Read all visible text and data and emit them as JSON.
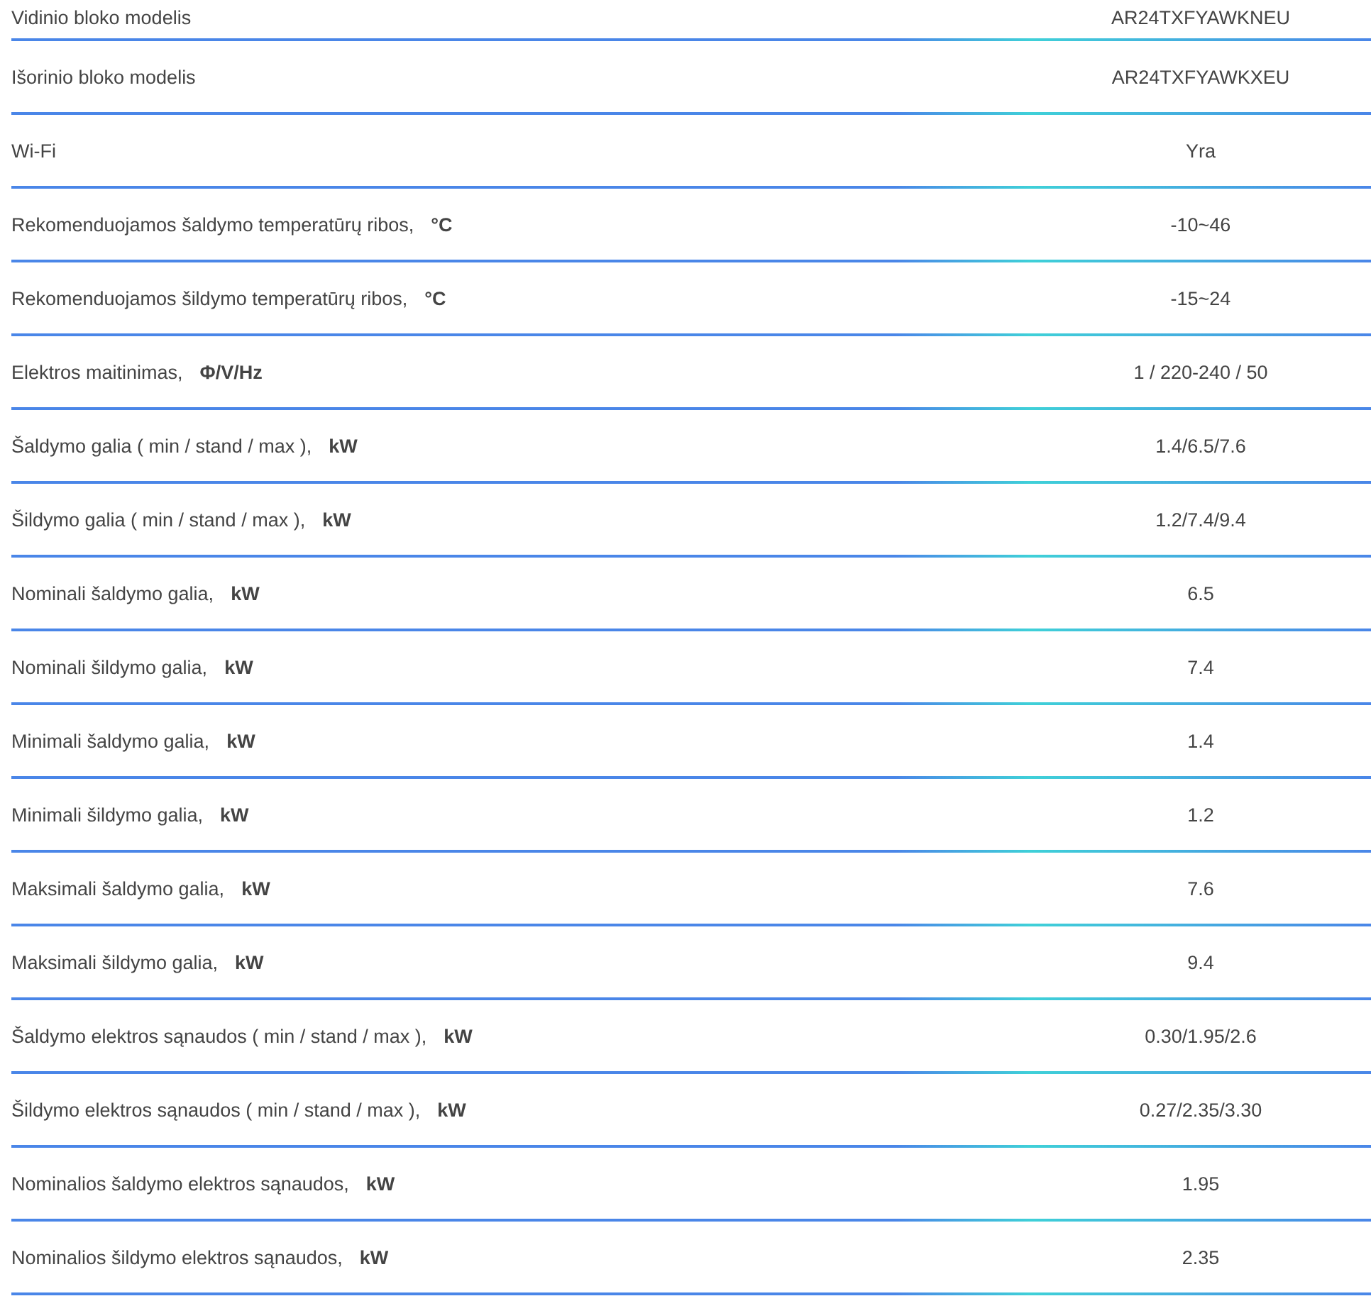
{
  "rows": [
    {
      "label": "Vidinio bloko modelis",
      "value": "AR24TXFYAWKNEU"
    },
    {
      "label": "Išorinio bloko modelis",
      "value": "AR24TXFYAWKXEU"
    },
    {
      "label": "Wi-Fi",
      "value": "Yra"
    },
    {
      "label": "Rekomenduojamos šaldymo temperatūrų ribos,",
      "unit": "°C",
      "value": "-10~46"
    },
    {
      "label": "Rekomenduojamos šildymo temperatūrų ribos,",
      "unit": "°C",
      "value": "-15~24"
    },
    {
      "label": "Elektros maitinimas,",
      "unit": "Φ/V/Hz",
      "value": "1 / 220-240 / 50"
    },
    {
      "label": "Šaldymo galia ( min / stand / max ),",
      "unit": "kW",
      "value": "1.4/6.5/7.6"
    },
    {
      "label": "Šildymo galia ( min / stand / max ),",
      "unit": "kW",
      "value": "1.2/7.4/9.4"
    },
    {
      "label": "Nominali šaldymo galia,",
      "unit": "kW",
      "value": "6.5"
    },
    {
      "label": "Nominali šildymo galia,",
      "unit": "kW",
      "value": "7.4"
    },
    {
      "label": "Minimali šaldymo galia,",
      "unit": "kW",
      "value": "1.4"
    },
    {
      "label": "Minimali šildymo galia,",
      "unit": "kW",
      "value": "1.2"
    },
    {
      "label": "Maksimali šaldymo galia,",
      "unit": "kW",
      "value": "7.6"
    },
    {
      "label": "Maksimali šildymo galia,",
      "unit": "kW",
      "value": "9.4"
    },
    {
      "label": "Šaldymo elektros sąnaudos ( min / stand / max ),",
      "unit": "kW",
      "value": "0.30/1.95/2.6"
    },
    {
      "label": "Šildymo elektros sąnaudos ( min / stand / max ),",
      "unit": "kW",
      "value": "0.27/2.35/3.30"
    },
    {
      "label": "Nominalios šaldymo elektros sąnaudos,",
      "unit": "kW",
      "value": "1.95"
    },
    {
      "label": "Nominalios šildymo elektros sąnaudos,",
      "unit": "kW",
      "value": "2.35"
    }
  ]
}
